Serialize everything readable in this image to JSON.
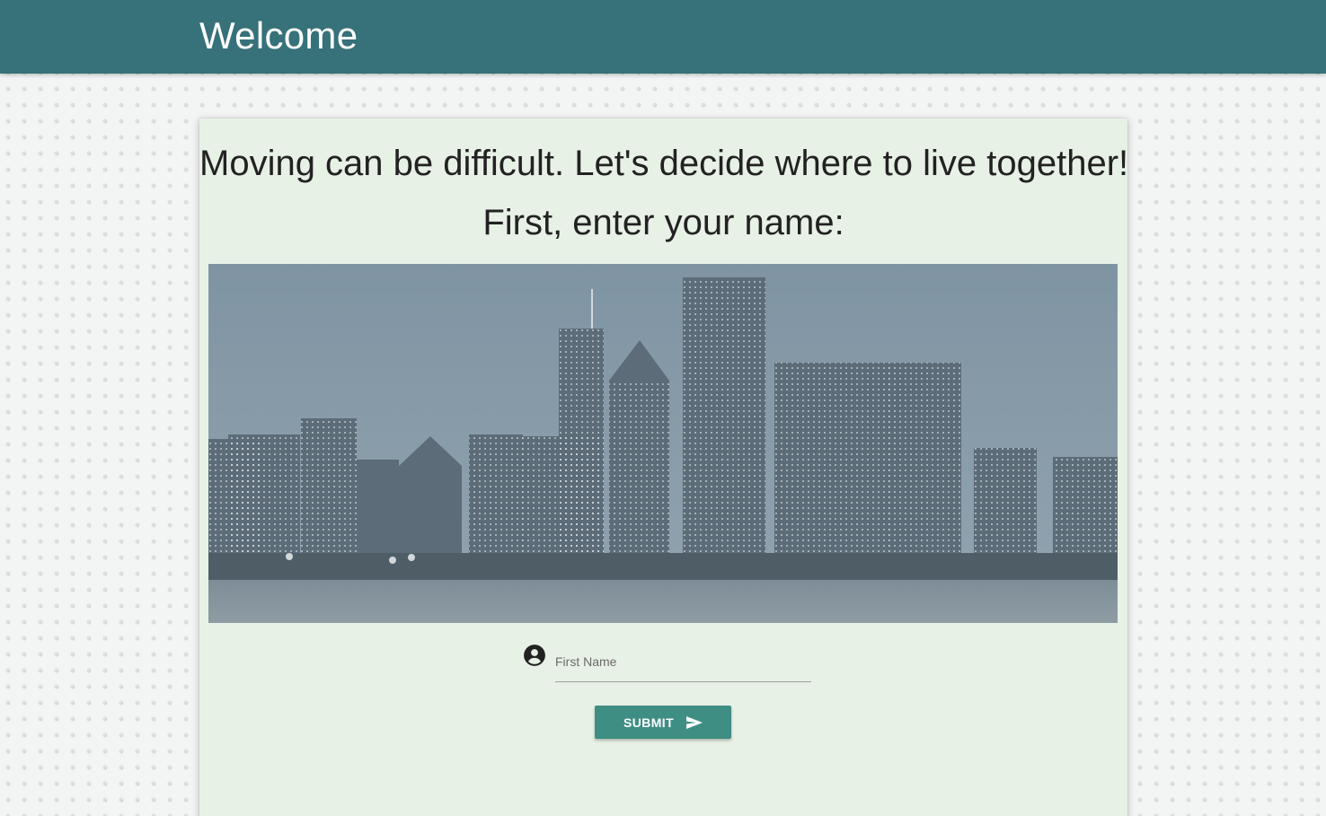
{
  "header": {
    "title": "Welcome"
  },
  "main": {
    "headline": "Moving can be difficult. Let's decide where to live together!",
    "subhead": "First, enter your name:",
    "hero_image": {
      "icon": "city-skyline-image"
    },
    "name_field": {
      "label": "First Name",
      "value": "",
      "icon": "account-circle-icon"
    },
    "submit": {
      "label": "SUBMIT",
      "icon": "send-icon"
    }
  },
  "colors": {
    "header_bg": "#37717a",
    "card_bg": "#e8f1e6",
    "button_bg": "#3e8e83"
  }
}
